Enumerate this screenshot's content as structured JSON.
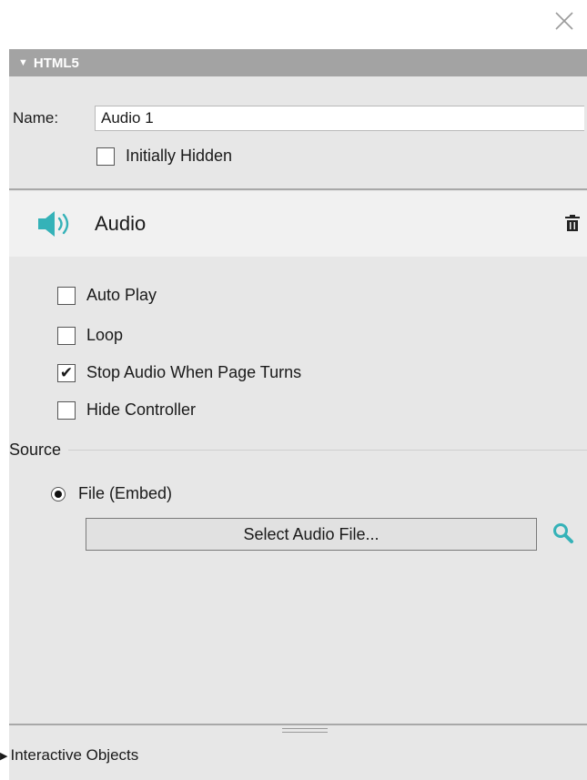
{
  "window": {
    "close_icon": "close-icon"
  },
  "section": {
    "title": "HTML5",
    "toggle_icon": "triangle-down-icon"
  },
  "name_field": {
    "label": "Name:",
    "value": "Audio 1"
  },
  "initially_hidden": {
    "label": "Initially Hidden",
    "checked": false
  },
  "audio_widget": {
    "title": "Audio",
    "icon": "speaker-icon",
    "delete_icon": "trash-icon",
    "accent_color": "#35b2b8"
  },
  "options": [
    {
      "label": "Auto Play",
      "checked": false
    },
    {
      "label": "Loop",
      "checked": false
    },
    {
      "label": "Stop Audio When Page Turns",
      "checked": true
    },
    {
      "label": "Hide Controller",
      "checked": false
    }
  ],
  "source": {
    "label": "Source",
    "radio_label": "File (Embed)",
    "radio_selected": true,
    "select_button": "Select Audio File...",
    "search_icon": "search-icon"
  },
  "footer": {
    "label": "Interactive Objects",
    "toggle_icon": "triangle-right-icon"
  }
}
